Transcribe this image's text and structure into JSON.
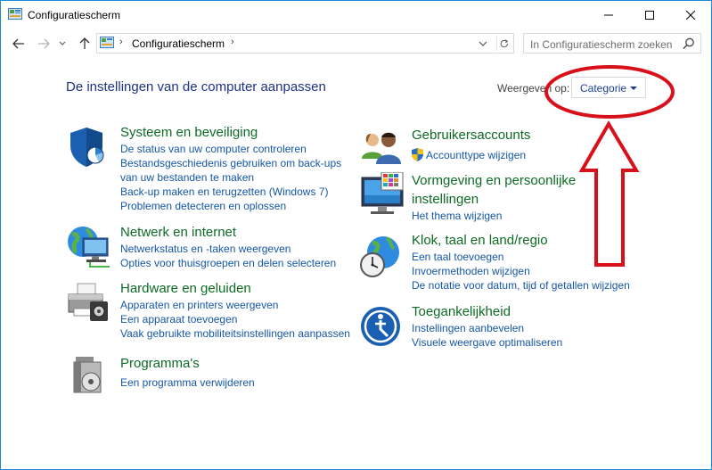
{
  "window": {
    "title": "Configuratiescherm"
  },
  "address": {
    "breadcrumb": "Configuratiescherm",
    "search_placeholder": "In Configuratiescherm zoeken"
  },
  "main": {
    "heading": "De instellingen van de computer aanpassen",
    "view_label": "Weergeven op:",
    "view_value": "Categorie"
  },
  "categories_left": [
    {
      "title": "Systeem en beveiliging",
      "icon": "shield-icon",
      "links": [
        "De status van uw computer controleren",
        "Bestandsgeschiedenis gebruiken om back-ups",
        "van uw bestanden te maken",
        "Back-up maken en terugzetten (Windows 7)",
        "Problemen detecteren en oplossen"
      ]
    },
    {
      "title": "Netwerk en internet",
      "icon": "network-globe-icon",
      "links": [
        "Netwerkstatus en -taken weergeven",
        "Opties voor thuisgroepen en delen selecteren"
      ]
    },
    {
      "title": "Hardware en geluiden",
      "icon": "printer-icon",
      "links": [
        "Apparaten en printers weergeven",
        "Een apparaat toevoegen",
        "Vaak gebruikte mobiliteitsinstellingen aanpassen"
      ]
    },
    {
      "title": "Programma's",
      "icon": "programs-icon",
      "links": [
        "Een programma verwijderen"
      ]
    }
  ],
  "categories_right": [
    {
      "title": "Gebruikersaccounts",
      "icon": "users-icon",
      "links": [
        "Accounttype wijzigen"
      ]
    },
    {
      "title": "Vormgeving en persoonlijke",
      "title2": "instellingen",
      "icon": "monitor-icon",
      "links": [
        "Het thema wijzigen"
      ]
    },
    {
      "title": "Klok, taal en land/regio",
      "icon": "clock-globe-icon",
      "links": [
        "Een taal toevoegen",
        "Invoermethoden wijzigen",
        "De notatie voor datum, tijd of getallen wijzigen"
      ]
    },
    {
      "title": "Toegankelijkheid",
      "icon": "accessibility-icon",
      "links": [
        "Instellingen aanbevelen",
        "Visuele weergave optimaliseren"
      ]
    }
  ],
  "colors": {
    "category_title": "#0d6b24",
    "link": "#1557a8",
    "heading": "#1e3287",
    "annotation": "#d8101a"
  }
}
